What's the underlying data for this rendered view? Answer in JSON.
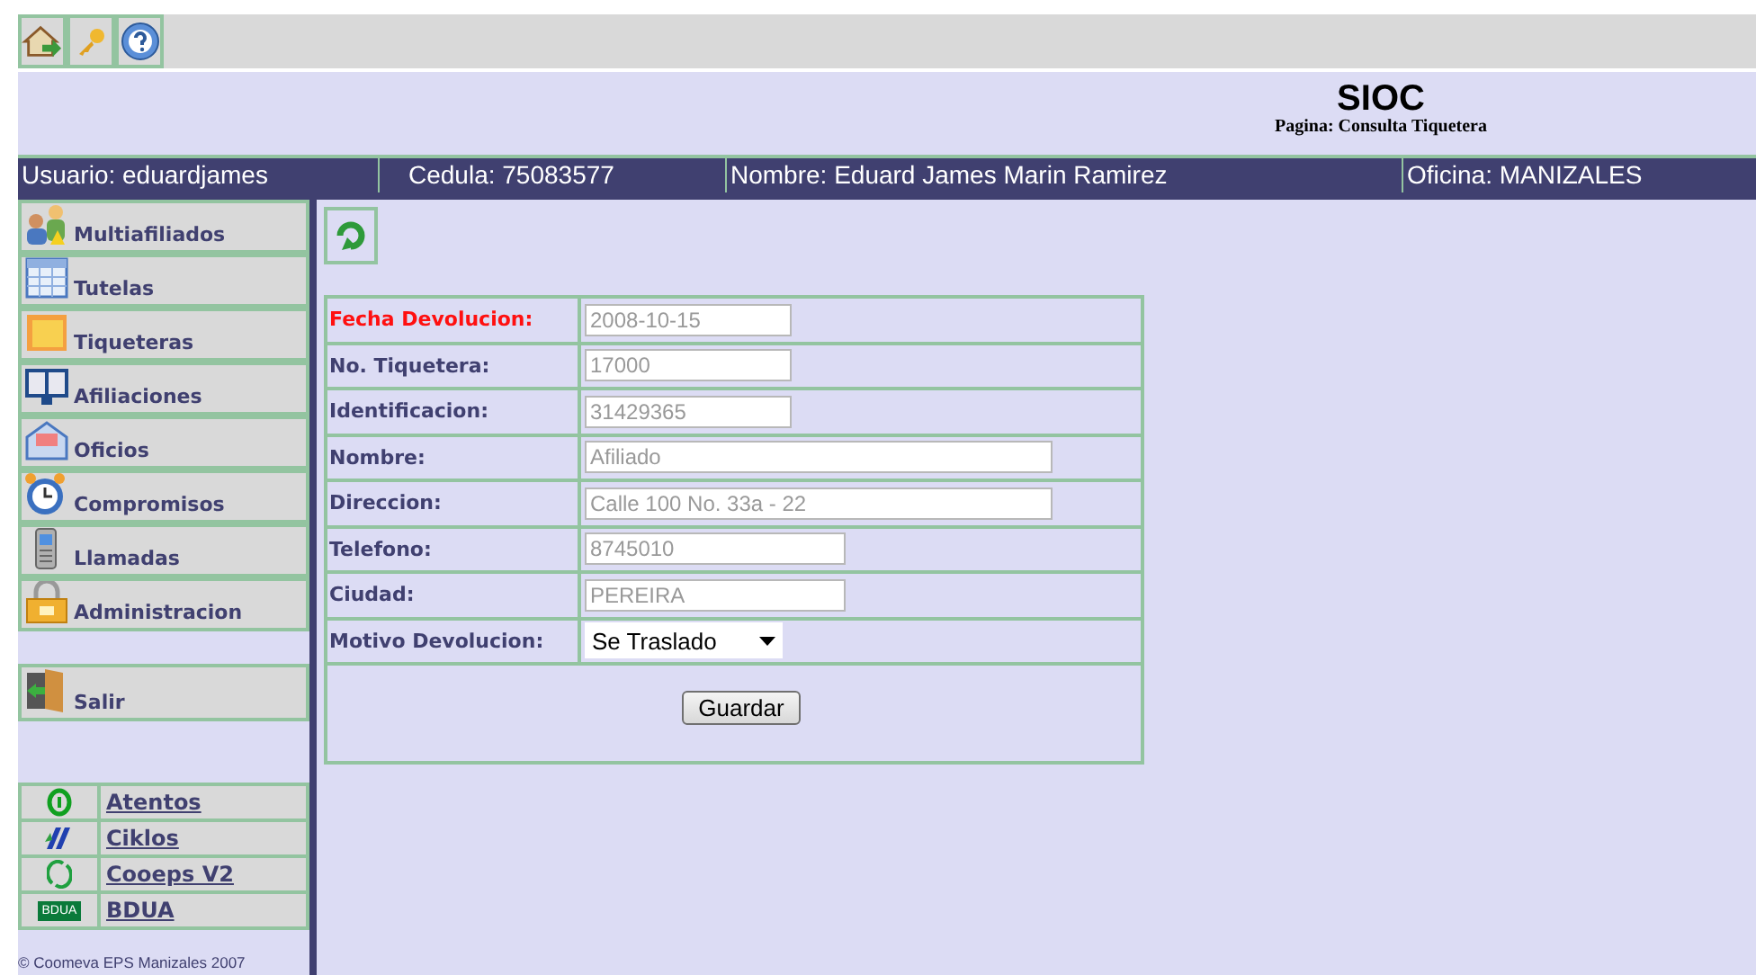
{
  "header": {
    "title": "SIOC",
    "subtitle": "Pagina: Consulta Tiquetera"
  },
  "info_bar": [
    "Usuario: eduardjames",
    "Cedula: 75083577",
    "Nombre: Eduard James Marin Ramirez",
    "Oficina: MANIZALES"
  ],
  "sidebar": {
    "items": [
      {
        "label": "Multiafiliados",
        "kind": "people"
      },
      {
        "label": "Tutelas",
        "kind": "table"
      },
      {
        "label": "Tiqueteras",
        "kind": "note"
      },
      {
        "label": "Afiliaciones",
        "kind": "book"
      },
      {
        "label": "Oficios",
        "kind": "mail"
      },
      {
        "label": "Compromisos",
        "kind": "clock"
      },
      {
        "label": "Llamadas",
        "kind": "phone"
      },
      {
        "label": "Administracion",
        "kind": "lock"
      }
    ],
    "exit": {
      "label": "Salir"
    },
    "links": [
      {
        "label": "Atentos",
        "kind": "ring"
      },
      {
        "label": "Ciklos",
        "kind": "stripes"
      },
      {
        "label": "Cooeps V2",
        "kind": "recycle"
      },
      {
        "label": "BDUA",
        "kind": "badge",
        "badge": "BDUA"
      }
    ],
    "footer": "© Coomeva EPS Manizales 2007"
  },
  "form": {
    "rows": [
      {
        "label": "Fecha Devolucion:",
        "highlight": true,
        "kind": "field",
        "value": "2008-10-15",
        "disabled": true
      },
      {
        "label": "No. Tiquetera:",
        "highlight": false,
        "kind": "field",
        "value": "17000",
        "disabled": true
      },
      {
        "label": "Identificacion:",
        "highlight": false,
        "kind": "field",
        "value": "31429365",
        "disabled": true
      },
      {
        "label": "Nombre:",
        "highlight": false,
        "kind": "field",
        "value": "Afiliado",
        "disabled": true
      },
      {
        "label": "Direccion:",
        "highlight": false,
        "kind": "field",
        "value": "Calle 100 No. 33a - 22",
        "disabled": true
      },
      {
        "label": "Telefono:",
        "highlight": false,
        "kind": "field",
        "value": "8745010",
        "disabled": true
      },
      {
        "label": "Ciudad:",
        "highlight": false,
        "kind": "field",
        "value": "PEREIRA",
        "disabled": true
      },
      {
        "label": "Motivo Devolucion:",
        "highlight": false,
        "kind": "select",
        "value": "Se Traslado"
      }
    ],
    "button": "Guardar"
  }
}
